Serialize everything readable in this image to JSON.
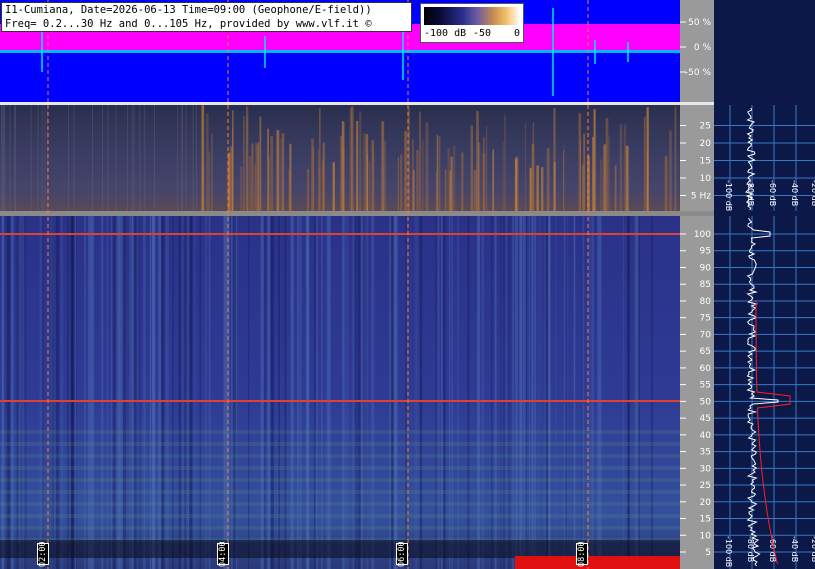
{
  "header": {
    "line1": "I1-Cumiana, Date=2026-06-13 Time=09:00 (Geophone/E-field))",
    "line2": "Freq= 0.2...30 Hz and 0...105 Hz, provided by www.vlf.it ©"
  },
  "colorbar": {
    "labels": [
      "-100 dB",
      "-50",
      "0"
    ]
  },
  "time_labels": [
    "02:00",
    "04:00",
    "06:00",
    "08:00"
  ],
  "chart_data": [
    {
      "type": "line",
      "panel": "amplitude",
      "ylabel": "%",
      "yticks": [
        "50 %",
        "0 %",
        "-50 %"
      ],
      "ylim": [
        -100,
        100
      ],
      "colors": {
        "background": "#0000ff",
        "positive": "#ff00ff",
        "signal": "#00e5ff"
      }
    },
    {
      "type": "heatmap",
      "panel": "spectrogram-low",
      "yticks": [
        "25",
        "20",
        "15",
        "10",
        "5 Hz"
      ],
      "ylim": [
        0,
        30
      ],
      "spectrum_xticks": [
        "-100 dB",
        "-80 dB",
        "-60 dB",
        "-40 dB",
        "-20 dB"
      ]
    },
    {
      "type": "heatmap",
      "panel": "spectrogram-high",
      "yticks": [
        "100",
        "95",
        "90",
        "85",
        "80",
        "75",
        "70",
        "65",
        "60",
        "55",
        "50",
        "45",
        "40",
        "35",
        "30",
        "25",
        "20",
        "15",
        "10",
        "5"
      ],
      "ylim": [
        0,
        105
      ],
      "spectrum_xticks": [
        "-100 dB",
        "-80 dB",
        "-60 dB",
        "-40 dB",
        "-20 dB"
      ],
      "lines_hz": [
        100,
        50
      ]
    }
  ]
}
